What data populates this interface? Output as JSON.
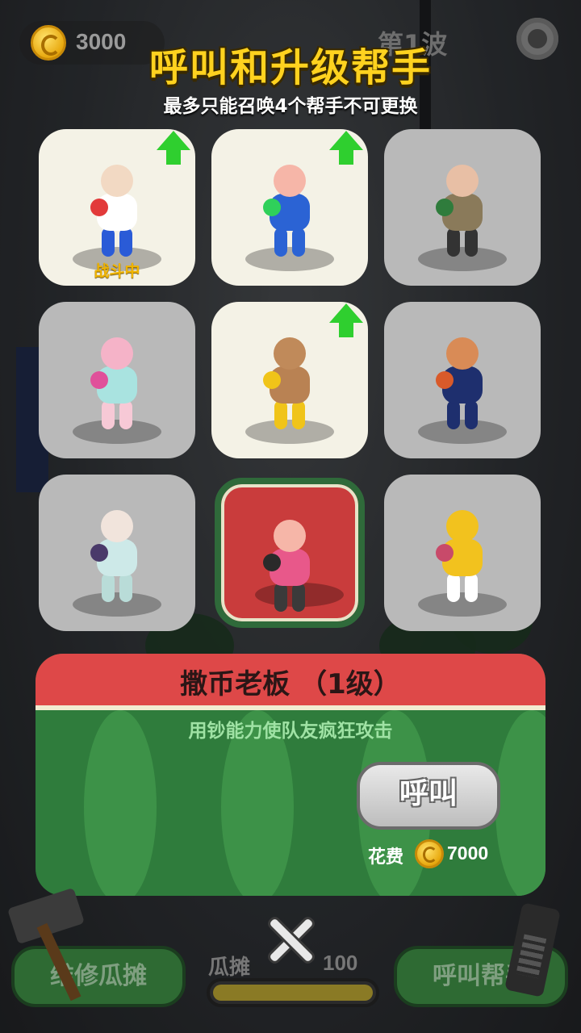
{
  "hud": {
    "coins": "3000",
    "wave": "第1波"
  },
  "header": {
    "title": "呼叫和升级帮手",
    "subtitle": "最多只能召唤4个帮手不可更换"
  },
  "helpers": [
    {
      "status": "owned",
      "upgrade": true,
      "fighting_label": "战斗中",
      "head": "#f2d9c3",
      "body": "#ffffff",
      "legs": "#2a5bd7",
      "accent": "#e23a3a"
    },
    {
      "status": "owned",
      "upgrade": true,
      "fighting_label": "",
      "head": "#f6b6a8",
      "body": "#2b63d4",
      "legs": "#2b63d4",
      "accent": "#2fd05a"
    },
    {
      "status": "locked",
      "upgrade": false,
      "fighting_label": "",
      "head": "#e8bfa5",
      "body": "#8a7a5a",
      "legs": "#333333",
      "accent": "#2f7c3c"
    },
    {
      "status": "locked",
      "upgrade": false,
      "fighting_label": "",
      "head": "#f5b3c8",
      "body": "#a9e3e0",
      "legs": "#f7c9d6",
      "accent": "#e0509a"
    },
    {
      "status": "owned",
      "upgrade": true,
      "fighting_label": "",
      "head": "#c08a5a",
      "body": "#b98253",
      "legs": "#f0c419",
      "accent": "#f0c419"
    },
    {
      "status": "locked",
      "upgrade": false,
      "fighting_label": "",
      "head": "#d98b56",
      "body": "#1e2f6e",
      "legs": "#1e2f6e",
      "accent": "#d95a2a"
    },
    {
      "status": "locked",
      "upgrade": false,
      "fighting_label": "",
      "head": "#f1e4dc",
      "body": "#cde9e8",
      "legs": "#b9dcd8",
      "accent": "#4a3a6a"
    },
    {
      "status": "selected",
      "upgrade": false,
      "fighting_label": "",
      "head": "#f6b6a8",
      "body": "#e8588a",
      "legs": "#3a3a3a",
      "accent": "#2a2a2a"
    },
    {
      "status": "locked",
      "upgrade": false,
      "fighting_label": "",
      "head": "#f2c21e",
      "body": "#f2c21e",
      "legs": "#ffffff",
      "accent": "#c84a6a"
    }
  ],
  "selected": {
    "name": "撒币老板 （1级）",
    "description": "用钞能力使队友疯狂攻击",
    "call_label": "呼叫",
    "cost_label": "花费",
    "cost_value": "7000"
  },
  "bottom": {
    "repair_label": "维修瓜摊",
    "stall_label": "瓜摊",
    "stall_value": "100",
    "stall_fill_fraction": 1.0,
    "call_helper_label": "呼叫帮手"
  },
  "colors": {
    "title": "#ffd21f",
    "panel_green": "#2f7c3c",
    "panel_red": "#de4848",
    "upgrade_arrow": "#2fcf2f",
    "fighting": "#f0b400"
  },
  "icons": [
    "coin-icon",
    "gear-icon",
    "upgrade-arrow-icon",
    "close-icon",
    "hammer-icon",
    "phone-icon"
  ]
}
